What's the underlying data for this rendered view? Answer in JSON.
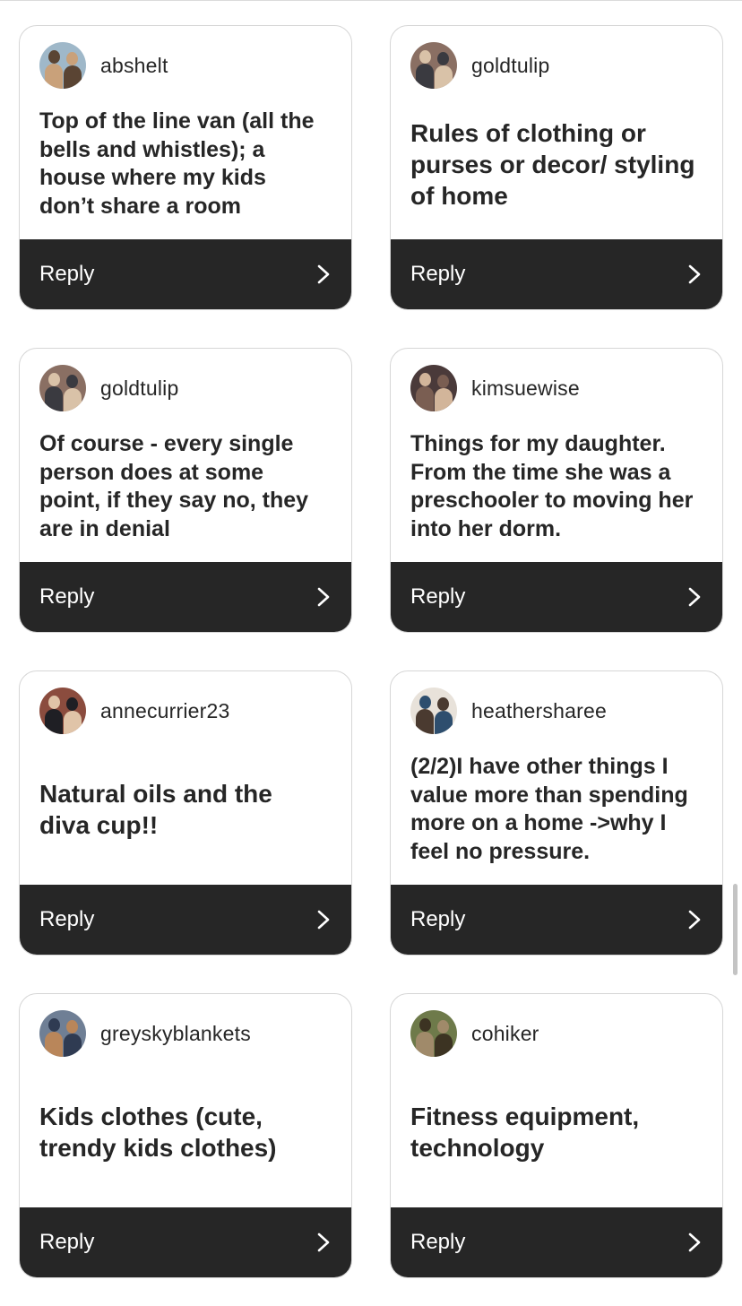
{
  "reply_label": "Reply",
  "cards": [
    {
      "username": "abshelt",
      "comment": "Top of the line van (all the bells and whistles); a house where my kids don’t share a room",
      "comment_size": "small",
      "avatar": {
        "bg": "#9fb8c9",
        "fg": "#c9a17a",
        "accent": "#5a4433"
      }
    },
    {
      "username": "goldtulip",
      "comment": "Rules of clothing or purses or decor/ styling of home",
      "comment_size": "large",
      "avatar": {
        "bg": "#8a6f63",
        "fg": "#3a3a40",
        "accent": "#d9c2a8"
      }
    },
    {
      "username": "goldtulip",
      "comment": "Of course - every single person does at some point, if they say no, they are in denial",
      "comment_size": "small",
      "avatar": {
        "bg": "#8a6f63",
        "fg": "#3a3a40",
        "accent": "#d9c2a8"
      }
    },
    {
      "username": "kimsuewise",
      "comment": "Things for my daughter. From the time she was a preschooler to moving her into her dorm.",
      "comment_size": "small",
      "avatar": {
        "bg": "#4a3a3a",
        "fg": "#7a5e52",
        "accent": "#d2b59a"
      }
    },
    {
      "username": "annecurrier23",
      "comment": "Natural oils and the diva cup!!",
      "comment_size": "large",
      "avatar": {
        "bg": "#8b4c3e",
        "fg": "#1f1f24",
        "accent": "#e0c4a8"
      }
    },
    {
      "username": "heathersharee",
      "comment": "(2/2)I have other things I value more than spending more on a home ->why I feel no pressure.",
      "comment_size": "small",
      "avatar": {
        "bg": "#e8e2da",
        "fg": "#4a3a30",
        "accent": "#2e4e6e"
      }
    },
    {
      "username": "greyskyblankets",
      "comment": "Kids clothes (cute, trendy kids clothes)",
      "comment_size": "large",
      "avatar": {
        "bg": "#6f7f95",
        "fg": "#b9865a",
        "accent": "#2f3b52"
      }
    },
    {
      "username": "cohiker",
      "comment": "Fitness equipment, technology",
      "comment_size": "large",
      "avatar": {
        "bg": "#6e7a4a",
        "fg": "#a08a6a",
        "accent": "#3c3322"
      }
    }
  ],
  "colors": {
    "reply_bar": "#262626",
    "card_border": "#d6d6d6",
    "text": "#262626"
  },
  "icons": {
    "reply_chevron": "chevron-right-icon"
  }
}
